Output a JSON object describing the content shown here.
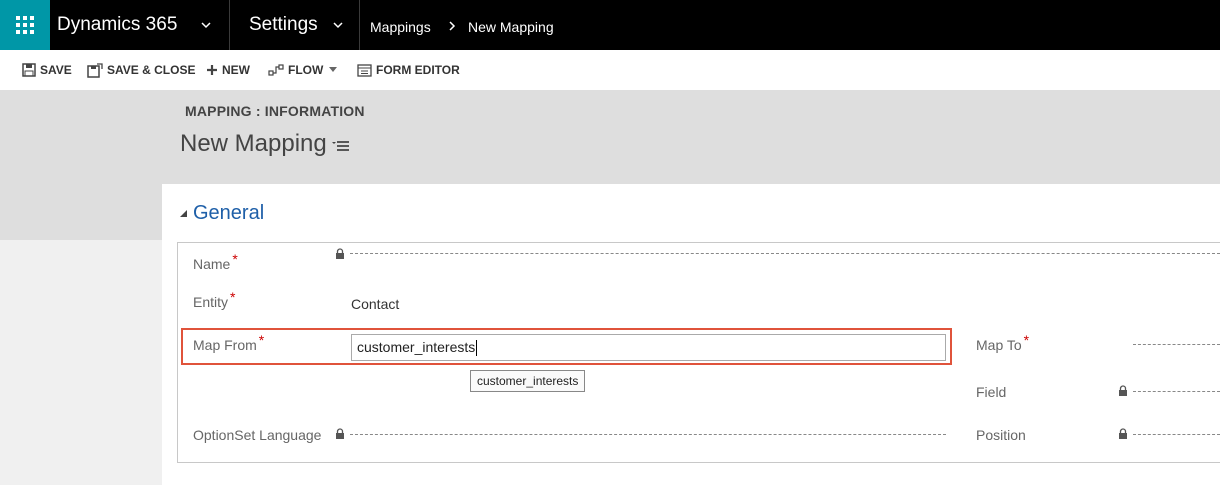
{
  "nav": {
    "app_name": "Dynamics 365",
    "area": "Settings",
    "breadcrumb": [
      "Mappings",
      "New Mapping"
    ]
  },
  "toolbar": {
    "save": "SAVE",
    "save_close": "SAVE & CLOSE",
    "new": "NEW",
    "flow": "FLOW",
    "form_editor": "FORM EDITOR"
  },
  "header": {
    "entity_label": "MAPPING : INFORMATION",
    "title": "New Mapping"
  },
  "section": {
    "title": "General"
  },
  "fields": {
    "name_label": "Name",
    "entity_label": "Entity",
    "entity_value": "Contact",
    "map_from_label": "Map From",
    "map_from_value": "customer_interests",
    "map_from_tooltip": "customer_interests",
    "optionset_label": "OptionSet Language",
    "map_to_label": "Map To",
    "field_label": "Field",
    "position_label": "Position"
  },
  "colors": {
    "accent": "#0097a7",
    "section_title": "#1e5fa8",
    "highlight": "#e0533b",
    "required": "#cc0000"
  }
}
